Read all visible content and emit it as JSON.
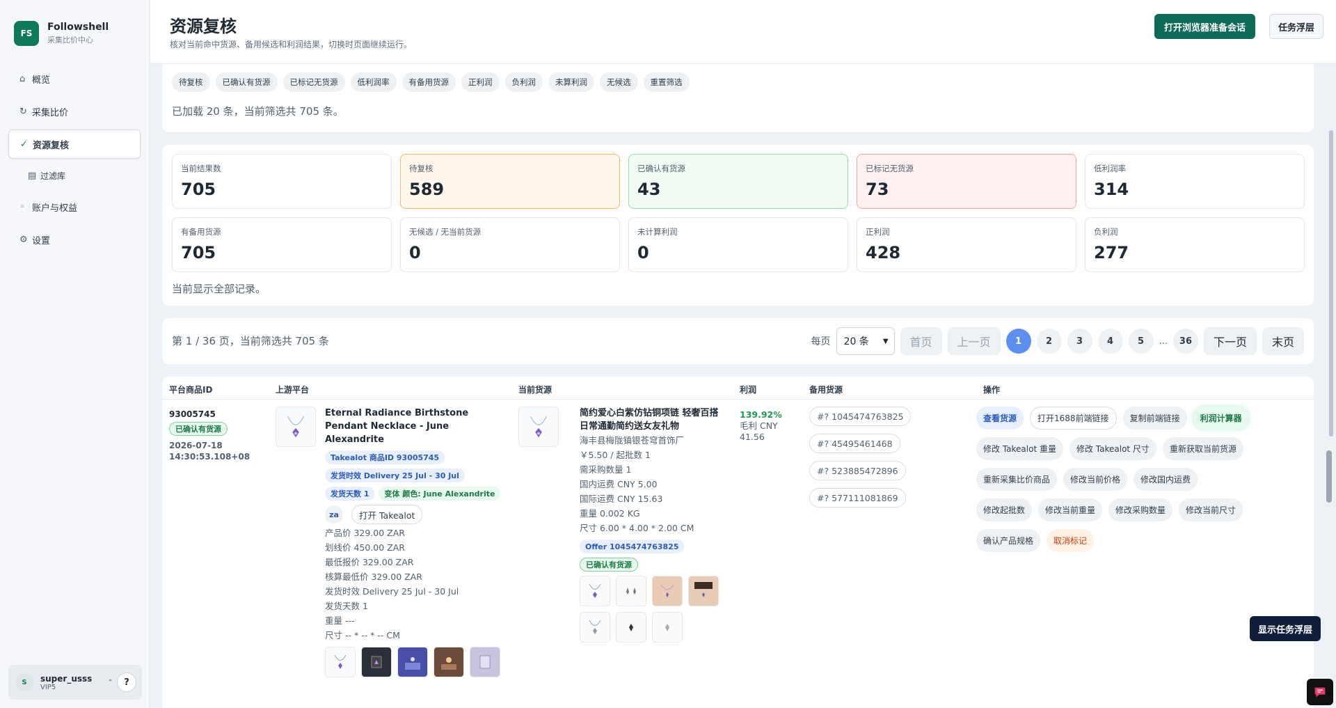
{
  "brand": {
    "logo": "FS",
    "name": "Followshell",
    "subtitle": "采集比价中心"
  },
  "sidebar": {
    "items": [
      {
        "label": "概览",
        "icon": "⌂"
      },
      {
        "label": "采集比价",
        "icon": "↻"
      },
      {
        "label": "资源复核",
        "icon": "✓"
      },
      {
        "label": "过滤库",
        "icon": "▤"
      },
      {
        "label": "账户与权益",
        "icon": "◦"
      },
      {
        "label": "设置",
        "icon": "⚙"
      }
    ]
  },
  "user": {
    "avatar": "S",
    "name": "super_usss",
    "level": "VIP5",
    "caret": "⌃",
    "help": "?"
  },
  "header": {
    "title": "资源复核",
    "subtitle": "核对当前命中货源、备用候选和利润结果，切换时页面继续运行。",
    "primary_button": "打开浏览器准备会话",
    "secondary_button": "任务浮层"
  },
  "filters": {
    "chips": [
      "待复核",
      "已确认有货源",
      "已标记无货源",
      "低利润率",
      "有备用货源",
      "正利润",
      "负利润",
      "未算利润",
      "无候选",
      "重置筛选"
    ],
    "loaded_text": "已加载 20 条，当前筛选共 705 条。"
  },
  "stats": {
    "items": [
      {
        "label": "当前结果数",
        "value": "705"
      },
      {
        "label": "待复核",
        "value": "589"
      },
      {
        "label": "已确认有货源",
        "value": "43"
      },
      {
        "label": "已标记无货源",
        "value": "73"
      },
      {
        "label": "低利润率",
        "value": "314"
      },
      {
        "label": "有备用货源",
        "value": "705"
      },
      {
        "label": "无候选 / 无当前货源",
        "value": "0"
      },
      {
        "label": "未计算利润",
        "value": "0"
      },
      {
        "label": "正利润",
        "value": "428"
      },
      {
        "label": "负利润",
        "value": "277"
      }
    ],
    "all_shown_text": "当前显示全部记录。"
  },
  "pagination": {
    "info": "第 1 / 36 页，当前筛选共 705 条",
    "per_page_label": "每页",
    "per_page_value": "20 条",
    "first": "首页",
    "prev": "上一页",
    "pages": [
      "1",
      "2",
      "3",
      "4",
      "5"
    ],
    "ellipsis": "...",
    "last_page": "36",
    "next": "下一页",
    "last": "末页"
  },
  "table": {
    "headers": {
      "id": "平台商品ID",
      "upstream": "上游平台",
      "source": "当前货源",
      "profit": "利润",
      "backup": "备用货源",
      "actions": "操作"
    },
    "row": {
      "product_id": "93005745",
      "status": "已确认有货源",
      "timestamp": "2026-07-18 14:30:53.108+08",
      "upstream": {
        "title": "Eternal Radiance Birthstone Pendant Necklace - June Alexandrite",
        "tag_id": "Takealot 商品ID 93005745",
        "tag_delivery": "发货时效 Delivery 25 Jul - 30 Jul",
        "tag_days": "发货天数 1",
        "tag_variant": "变体 颜色: June Alexandrite",
        "za": "za",
        "open_link": "打开 Takealot",
        "lines": [
          "产品价 329.00 ZAR",
          "划线价 450.00 ZAR",
          "最低报价 329.00 ZAR",
          "核算最低价 329.00 ZAR",
          "发货时效 Delivery 25 Jul - 30 Jul",
          "发货天数 1",
          "重量 ---",
          "尺寸 -- * -- * -- CM"
        ]
      },
      "source": {
        "title": "简约爱心白紫仿钻铜项链 轻奢百搭日常通勤简约送女友礼物",
        "lines": [
          "海丰县梅陇镇银苍穹首饰厂",
          "￥5.50 / 起批数 1",
          "需采购数量 1",
          "国内运费 CNY 5.00",
          "国际运费 CNY 15.63",
          "重量 0.002 KG",
          "尺寸 6.00 * 4.00 * 2.00 CM"
        ],
        "offer": "Offer 1045474763825",
        "status": "已确认有货源"
      },
      "profit": {
        "pct": "139.92%",
        "gross_label": "毛利 CNY",
        "gross_value": "41.56"
      },
      "backups": [
        "#? 1045474763825",
        "#? 45495461468",
        "#? 523885472896",
        "#? 577111081869"
      ],
      "actions": [
        "查看货源",
        "打开1688前端链接",
        "复制前端链接",
        "利润计算器",
        "修改 Takealot 重量",
        "修改 Takealot 尺寸",
        "重新获取当前货源",
        "重新采集比价商品",
        "修改当前价格",
        "修改国内运费",
        "修改起批数",
        "修改当前重量",
        "修改采购数量",
        "修改当前尺寸",
        "确认产品规格",
        "取消标记"
      ]
    }
  },
  "float_button": "显示任务浮层",
  "colors": {
    "brand": "#0f7a5a",
    "primary_button": "#0f6b57",
    "active_page": "#5c8ff0",
    "profit_positive": "#1e9a52"
  }
}
